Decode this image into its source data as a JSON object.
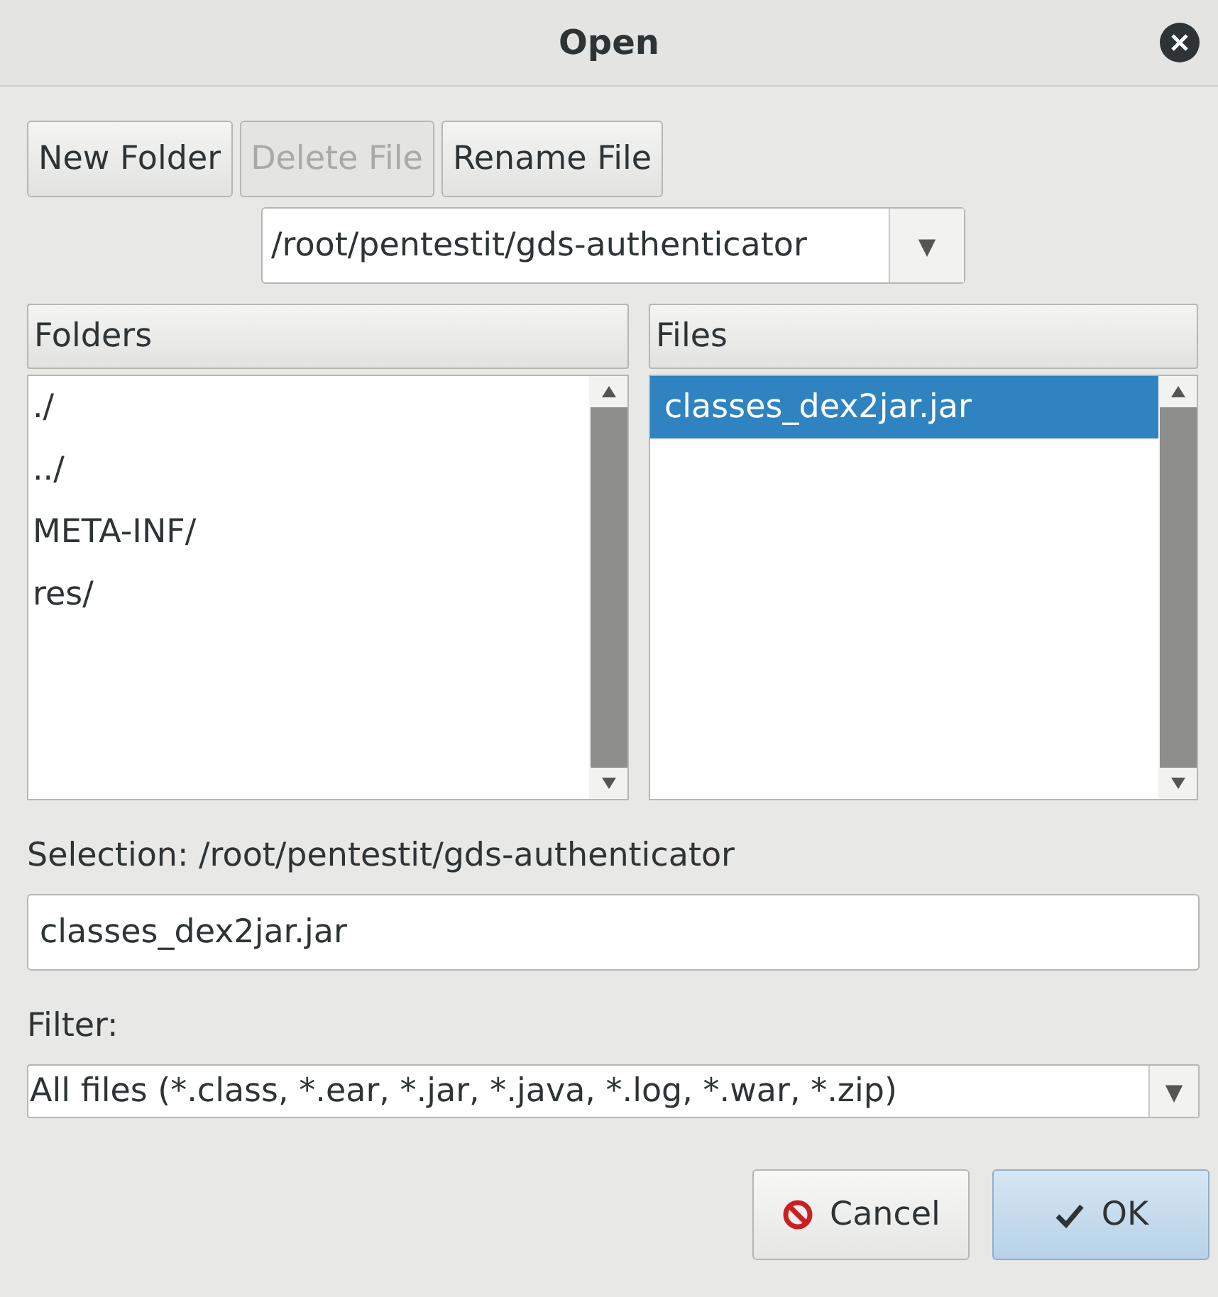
{
  "window": {
    "title": "Open"
  },
  "toolbar": [
    {
      "label": "New Folder",
      "disabled": false
    },
    {
      "label": "Delete File",
      "disabled": true
    },
    {
      "label": "Rename File",
      "disabled": false
    }
  ],
  "path": {
    "value": "/root/pentestit/gds-authenticator",
    "arrow": "▼"
  },
  "folders": {
    "header": "Folders",
    "items": [
      {
        "label": "./",
        "selected": false
      },
      {
        "label": "../",
        "selected": false
      },
      {
        "label": "META-INF/",
        "selected": false
      },
      {
        "label": "res/",
        "selected": false
      }
    ]
  },
  "files": {
    "header": "Files",
    "items": [
      {
        "label": "classes_dex2jar.jar",
        "selected": true
      }
    ]
  },
  "selection": {
    "label": "Selection: /root/pentestit/gds-authenticator",
    "value": "classes_dex2jar.jar"
  },
  "filter": {
    "label": "Filter:",
    "value": "All files (*.class, *.ear, *.jar, *.java, *.log, *.war, *.zip)",
    "arrow": "▼"
  },
  "buttons": [
    {
      "label": "Cancel",
      "kind": "cancel"
    },
    {
      "label": "OK",
      "kind": "ok"
    }
  ]
}
